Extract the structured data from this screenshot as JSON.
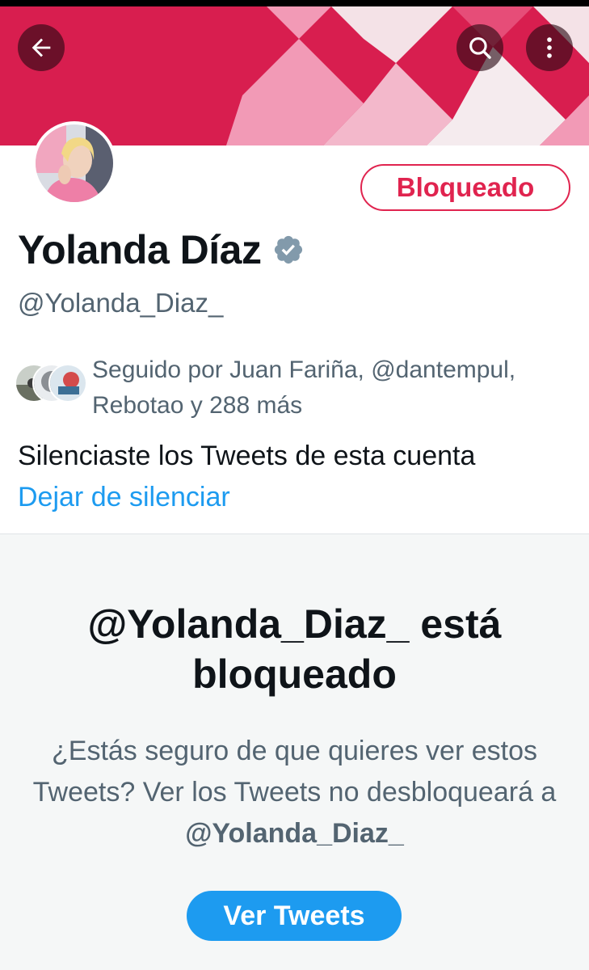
{
  "header": {
    "back_icon": "arrow-left-icon",
    "search_icon": "search-icon",
    "more_icon": "more-vertical-icon",
    "banner_colors": [
      "#d81e4f",
      "#f29ab6",
      "#f7f7f7"
    ]
  },
  "profile": {
    "blocked_button_label": "Bloqueado",
    "display_name": "Yolanda Díaz",
    "verified_icon": "verified-badge-icon",
    "handle": "@Yolanda_Diaz_",
    "followed_by_line1": "Seguido por Juan Fariña, @dantempul,",
    "followed_by_line2": "Rebotao y 288 más",
    "muted_notice": "Silenciaste los Tweets de esta cuenta",
    "unmute_link": "Dejar de silenciar"
  },
  "blocked_panel": {
    "title": "@Yolanda_Diaz_ está bloqueado",
    "description_prefix": "¿Estás seguro de que quieres ver estos Tweets? Ver los Tweets no desbloqueará a",
    "description_handle": "@Yolanda_Diaz_",
    "view_button_label": "Ver Tweets"
  },
  "colors": {
    "accent_blue": "#1d9bf0",
    "blocked_red": "#e0244f",
    "text_primary": "#0f1419",
    "text_secondary": "#536471"
  }
}
